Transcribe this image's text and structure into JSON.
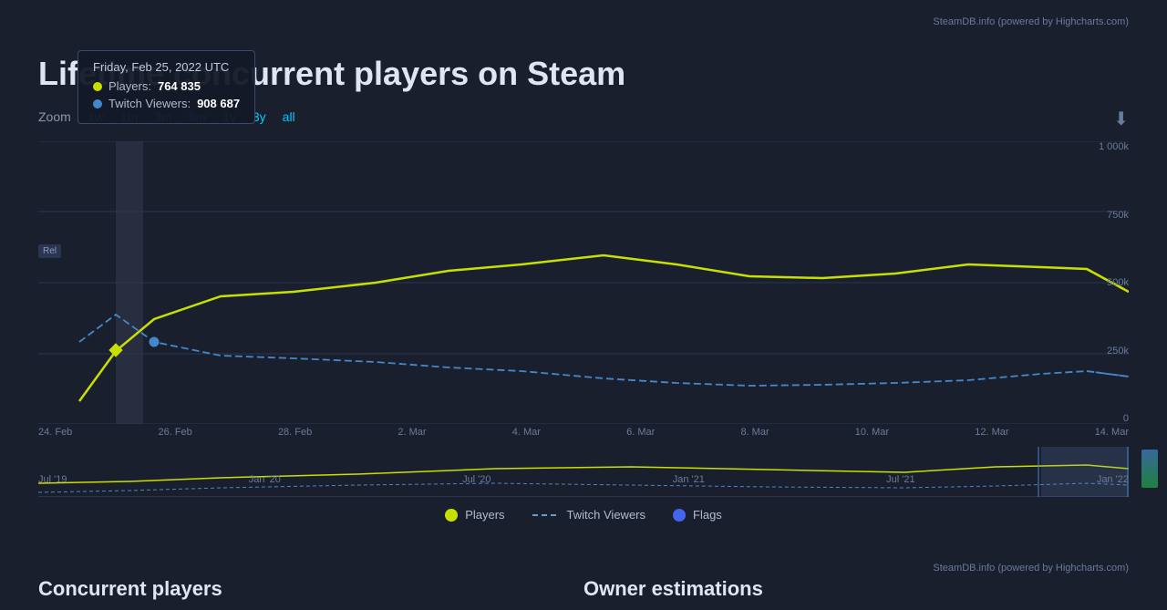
{
  "top_credit": "SteamDB.info (powered by Highcharts.com)",
  "page_title": "Lifetime concurrent players on Steam",
  "zoom": {
    "label": "Zoom",
    "options": [
      "1w",
      "1m",
      "3m",
      "6m",
      "1y",
      "3y",
      "all"
    ],
    "active": "1w"
  },
  "tooltip": {
    "date": "Friday, Feb 25, 2022 UTC",
    "players_label": "Players:",
    "players_value": "764 835",
    "twitch_label": "Twitch Viewers:",
    "twitch_value": "908 687"
  },
  "x_axis_labels": [
    "24. Feb",
    "26. Feb",
    "28. Feb",
    "2. Mar",
    "4. Mar",
    "6. Mar",
    "8. Mar",
    "10. Mar",
    "12. Mar",
    "14. Mar"
  ],
  "y_axis_labels": [
    "1 000k",
    "750k",
    "500k",
    "250k",
    "0"
  ],
  "mini_x_labels": [
    "Jul '19",
    "Jan '20",
    "Jul '20",
    "Jan '21",
    "Jul '21",
    "Jan '22"
  ],
  "legend": {
    "players_label": "Players",
    "twitch_label": "Twitch Viewers",
    "flags_label": "Flags"
  },
  "bottom_credit": "SteamDB.info (powered by Highcharts.com)",
  "section_concurrent": "Concurrent players",
  "section_owner": "Owner estimations",
  "rel_badge": "Rel"
}
